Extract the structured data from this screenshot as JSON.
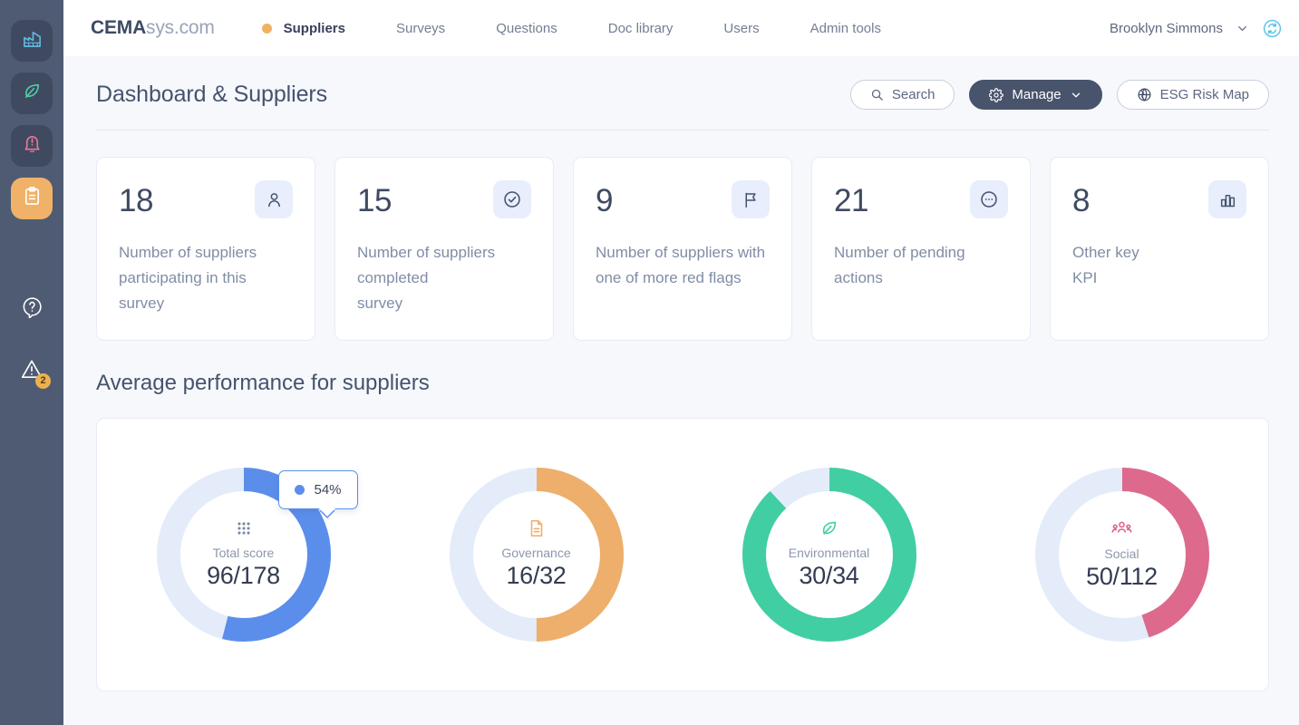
{
  "sidebar": {
    "items": [
      {
        "name": "factory-icon",
        "label": "Factory",
        "state": "dark",
        "color": "#62b9e0"
      },
      {
        "name": "leaf-icon",
        "label": "Environment",
        "state": "dark",
        "color": "#4ecfa4"
      },
      {
        "name": "bell-alert-icon",
        "label": "Alerts",
        "state": "dark",
        "color": "#e8779b"
      },
      {
        "name": "clipboard-icon",
        "label": "Surveys",
        "state": "active",
        "color": "#ffffff"
      }
    ],
    "bottom": [
      {
        "name": "help-icon",
        "label": "Help",
        "badge": ""
      },
      {
        "name": "warning-icon",
        "label": "Warnings",
        "badge": "2"
      }
    ]
  },
  "topnav": {
    "logo_bold": "CEMA",
    "logo_light": "sys.com",
    "links": [
      {
        "label": "Suppliers",
        "active": true
      },
      {
        "label": "Surveys",
        "active": false
      },
      {
        "label": "Questions",
        "active": false
      },
      {
        "label": "Doc library",
        "active": false
      },
      {
        "label": "Users",
        "active": false
      },
      {
        "label": "Admin tools",
        "active": false
      }
    ],
    "user": "Brooklyn Simmons"
  },
  "page": {
    "title": "Dashboard & Suppliers",
    "section_title": "Average performance for suppliers"
  },
  "toolbar": {
    "search_label": "Search",
    "manage_label": "Manage",
    "risk_map_label": "ESG Risk Map"
  },
  "kpis": [
    {
      "value": "18",
      "label": "Number of suppliers participating in this survey",
      "icon": "person-icon"
    },
    {
      "value": "15",
      "label": "Number of suppliers completed\nsurvey",
      "icon": "check-circle-icon"
    },
    {
      "value": "9",
      "label": "Number of suppliers with one of more red flags",
      "icon": "flag-icon"
    },
    {
      "value": "21",
      "label": "Number of pending actions",
      "icon": "dots-circle-icon"
    },
    {
      "value": "8",
      "label": "Other key\nKPI",
      "icon": "bar-chart-icon"
    }
  ],
  "chart_data": {
    "type": "pie",
    "title": "Average performance for suppliers",
    "legend": "none",
    "charts": [
      {
        "name": "Total score",
        "value": 96,
        "max": 178,
        "display": "96/178",
        "percent": 54,
        "color": "#5b8eeb",
        "track": "#e4ecfa",
        "icon": "grid-dots-icon"
      },
      {
        "name": "Governance",
        "value": 16,
        "max": 32,
        "display": "16/32",
        "percent": 50,
        "color": "#eeae6c",
        "track": "#e4ecfa",
        "icon": "document-icon"
      },
      {
        "name": "Environmental",
        "value": 30,
        "max": 34,
        "display": "30/34",
        "percent": 88,
        "color": "#41cea3",
        "track": "#e4ecfa",
        "icon": "leaf-icon"
      },
      {
        "name": "Social",
        "value": 50,
        "max": 112,
        "display": "50/112",
        "percent": 45,
        "color": "#dd6a8d",
        "track": "#e4ecfa",
        "icon": "people-icon"
      }
    ]
  },
  "tooltip": {
    "value": "54%",
    "color": "#5b8eeb"
  }
}
